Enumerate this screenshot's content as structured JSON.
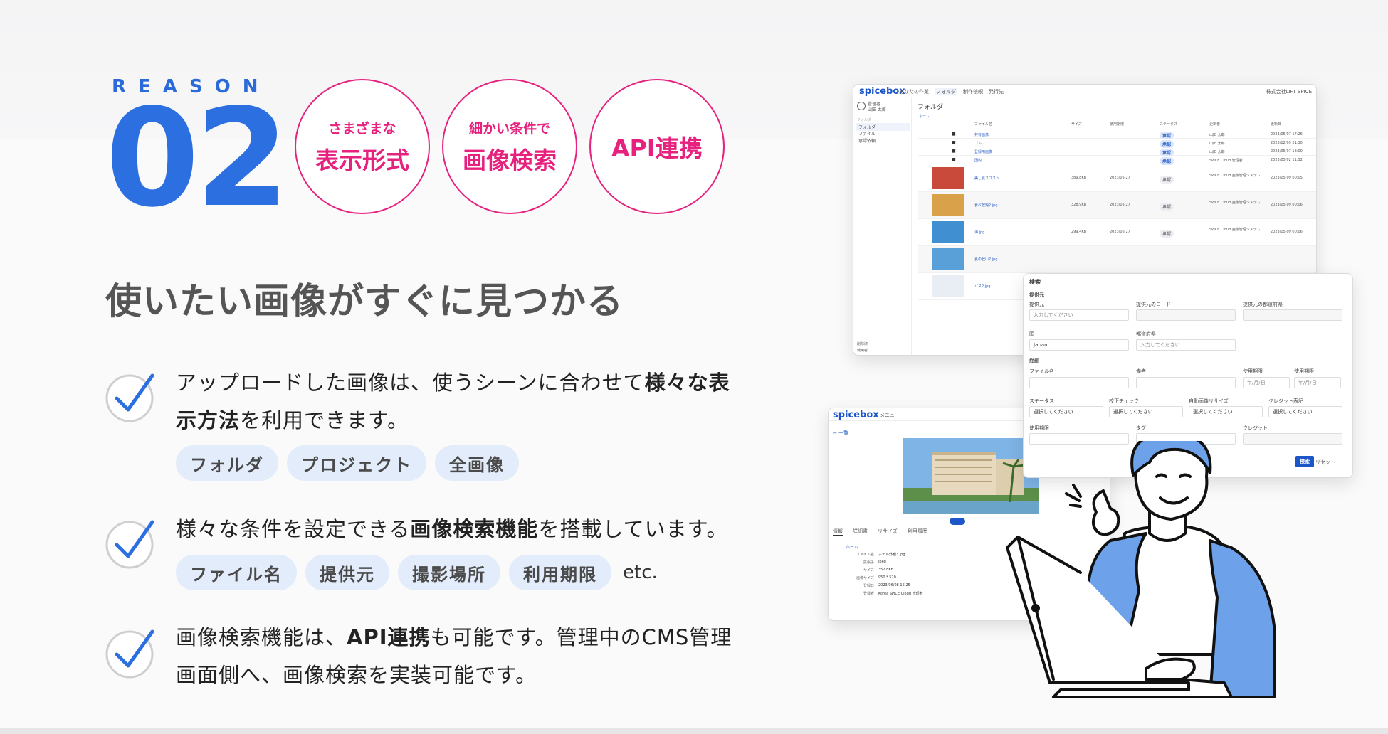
{
  "reason_label": "REASON",
  "reason_number": "02",
  "badges": [
    {
      "small": "さまざまな",
      "large": "表示形式"
    },
    {
      "small": "細かい条件で",
      "large": "画像検索"
    },
    {
      "small": "",
      "large": "API連携"
    }
  ],
  "headline": "使いたい画像がすぐに見つかる",
  "items": [
    {
      "text_pre": "アップロードした画像は、使うシーンに合わせて",
      "text_bold": "様々な表示方法",
      "text_post": "を利用できます。",
      "tags": [
        "フォルダ",
        "プロジェクト",
        "全画像"
      ]
    },
    {
      "text_pre": "様々な条件を設定できる",
      "text_bold": "画像検索機能",
      "text_post": "を搭載しています。",
      "tags": [
        "ファイル名",
        "提供元",
        "撮影場所",
        "利用期限"
      ],
      "suffix": "etc."
    },
    {
      "text_pre": "画像検索機能は、",
      "text_bold": "API連携",
      "text_post": "も可能です。管理中のCMS管理画面側へ、画像検索を実装可能です。"
    }
  ],
  "colors": {
    "accent_blue": "#2b6fe0",
    "accent_pink": "#e6217e",
    "tag_bg": "#e3ecfa"
  },
  "screenshots": {
    "main": {
      "logo": "spicebox",
      "nav": [
        "あなたの作業",
        "フォルダ",
        "制作依頼",
        "発行先"
      ],
      "company": "株式会社LIFT SPICE",
      "user": {
        "role": "管理者",
        "name": "山田 太郎"
      },
      "sidebar_label": "フォルダ",
      "sidebar": [
        "フォルダ",
        "ファイル",
        "承認依頼"
      ],
      "footer": [
        "削除済",
        "使用者"
      ],
      "title": "フォルダ",
      "breadcrumb": "ホーム",
      "columns": [
        "ファイル名",
        "サイズ",
        "使用期限",
        "ステータス",
        "更新者",
        "更新日"
      ],
      "folders": [
        {
          "name": "共有画像",
          "status": "承認",
          "user": "山田 太郎",
          "date": "2023/05/07 17:26"
        },
        {
          "name": "ゴルフ",
          "status": "承認",
          "user": "山田 太郎",
          "date": "2023/12/09 21:30"
        },
        {
          "name": "登録用画像",
          "status": "承認",
          "user": "山田 太郎",
          "date": "2023/05/07 18:00"
        },
        {
          "name": "国内",
          "status": "承認",
          "user": "SPICE Cloud 管理者",
          "date": "2023/05/02 11:52"
        }
      ],
      "files": [
        {
          "name": "美し肌スフスト",
          "size": "389.8KB",
          "limit": "2023/05/27",
          "status": "承認",
          "user": "SPICE Cloud 画像管理システム",
          "date": "2023/05/09 00:05"
        },
        {
          "name": "食べ放題2.jpg",
          "size": "328.9KB",
          "limit": "2023/05/27",
          "status": "承認",
          "user": "SPICE Cloud 画像管理システム",
          "date": "2023/05/09 00:06"
        },
        {
          "name": "海.jpg",
          "size": "299.4KB",
          "limit": "2023/05/27",
          "status": "承認",
          "user": "SPICE Cloud 画像管理システム",
          "date": "2023/05/09 00:06"
        },
        {
          "name": "夏の登山2.jpg",
          "size": "",
          "limit": "",
          "status": "",
          "user": "",
          "date": ""
        },
        {
          "name": "バス2.jpg",
          "size": "",
          "limit": "",
          "status": "",
          "user": "",
          "date": ""
        }
      ]
    },
    "detail": {
      "logo": "spicebox",
      "menu": "メニュー",
      "back": "← 一覧",
      "tabs": [
        "情報",
        "詳細書",
        "リサイズ",
        "利用履歴"
      ],
      "breadcrumb": "ホーム",
      "labels": [
        "ファイル名",
        "拡張子",
        "サイズ",
        "画像サイズ",
        "登録日",
        "登録者"
      ],
      "values": [
        "ホテル外観3.jpg",
        "jpeg",
        "352.8KB",
        "950 * 520",
        "2023/06/08 16:25",
        "Korea SPICE Cloud 管理者"
      ]
    },
    "search": {
      "title": "検索",
      "section1": "提供元",
      "labels1": [
        "提供元",
        "提供元のコード",
        "提供元の都道府県"
      ],
      "placeholder": "入力してください",
      "country_label": "国",
      "country_value": "Japan",
      "pref_label": "都道府県",
      "section2": "詳細",
      "labels2": [
        "ファイル名",
        "備考",
        "使用期限",
        "使用期限"
      ],
      "date_placeholder": "年/月/日",
      "labels3": [
        "ステータス",
        "校正チェック",
        "自動画像リサイズ",
        "クレジット表記"
      ],
      "select_placeholder": "選択してください",
      "labels4": [
        "使用期限",
        "タグ",
        "クレジット"
      ],
      "search_button": "検索",
      "reset_button": "リセット"
    }
  }
}
